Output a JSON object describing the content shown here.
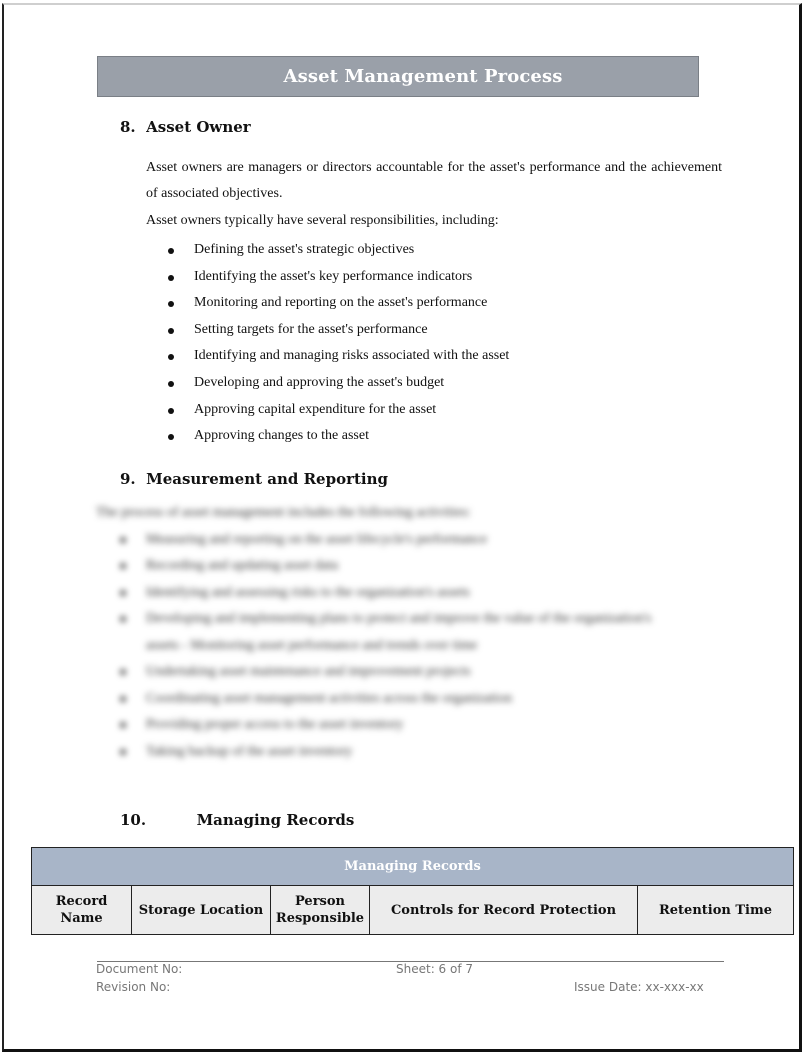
{
  "document": {
    "title": "Asset Management Process",
    "sections": [
      {
        "number": "8.",
        "heading": "Asset Owner",
        "paragraphs": [
          "Asset owners are managers or directors accountable for the asset's performance and the achievement of associated objectives.",
          "Asset owners typically have several responsibilities, including:"
        ],
        "bullets": [
          "Defining the asset's strategic objectives",
          "Identifying the asset's key performance indicators",
          "Monitoring and reporting on the asset's performance",
          "Setting targets for the asset's performance",
          "Identifying and managing risks associated with the asset",
          "Developing and approving the asset's budget",
          "Approving capital expenditure for the asset",
          "Approving changes to the asset"
        ]
      },
      {
        "number": "9.",
        "heading": "Measurement and Reporting",
        "blurred_intro": "The process of asset management includes the following activities:",
        "blurred_bullets": [
          "Measuring and reporting on the asset lifecycle's performance",
          "Recording and updating asset data",
          "Identifying and assessing risks to the organization's assets",
          "Developing and implementing plans to protect and improve the value of the organization's",
          "assets - Monitoring asset performance and trends over time",
          "Undertaking asset maintenance and improvement projects",
          "Coordinating asset management activities across the organization",
          "Providing proper access to the asset inventory",
          "Taking backup of the asset inventory"
        ]
      },
      {
        "number": "10.",
        "heading": "Managing Records"
      }
    ],
    "records_table": {
      "caption": "Managing Records",
      "columns": [
        "Record Name",
        "Storage Location",
        "Person Responsible",
        "Controls for Record Protection",
        "Retention Time"
      ],
      "column_lines": [
        [
          "Record",
          "Name"
        ],
        [
          "Storage Location"
        ],
        [
          "Person",
          "Responsible"
        ],
        [
          "Controls for Record Protection"
        ],
        [
          "Retention Time"
        ]
      ]
    },
    "footer": {
      "document_no": "Document No:",
      "revision_no": "Revision No:",
      "sheet": "Sheet: 6 of 7",
      "issue_date": "Issue Date: xx-xxx-xx"
    }
  },
  "colors": {
    "title_bar": "#9aa0a9",
    "table_caption": "#a8b5c8",
    "table_header": "#ececec"
  }
}
